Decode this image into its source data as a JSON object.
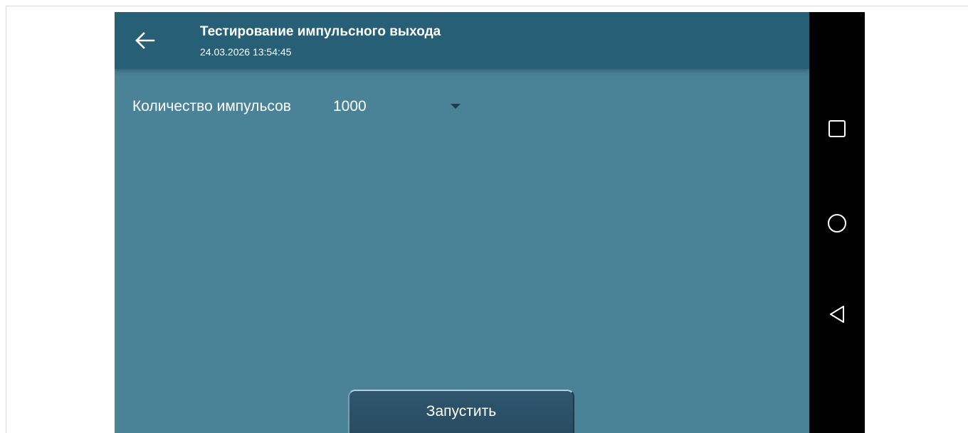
{
  "appbar": {
    "back_icon": "arrow-left-icon",
    "title": "Тестирование импульсного выхода",
    "subtitle": "24.03.2026 13:54:45"
  },
  "form": {
    "count_label": "Количество импульсов",
    "count_value": "1000",
    "dropdown_icon": "caret-down-icon"
  },
  "actions": {
    "start_label": "Запустить"
  },
  "navbar": {
    "recents_icon": "square-icon",
    "home_icon": "circle-icon",
    "back_icon": "triangle-back-icon"
  },
  "colors": {
    "appbar": "#275f76",
    "background": "#4a8297",
    "button": "#2b5068",
    "navbar": "#000000"
  }
}
